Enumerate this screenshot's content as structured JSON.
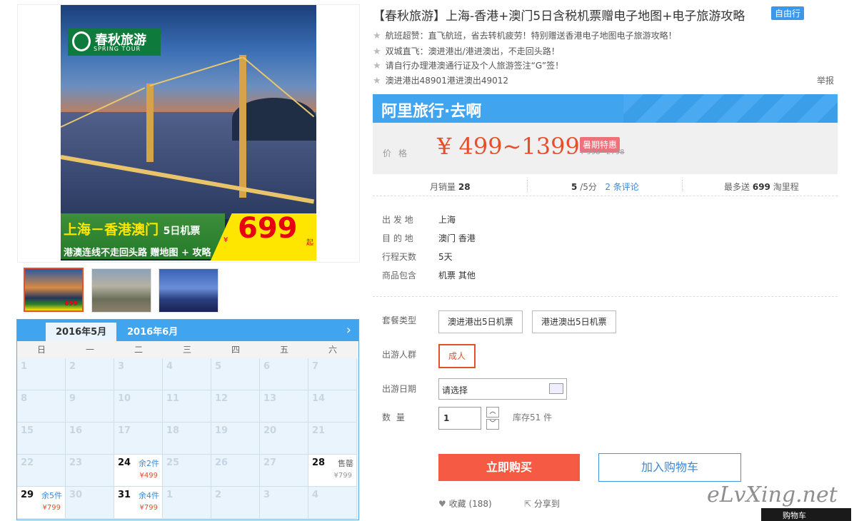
{
  "product": {
    "title": "【春秋旅游】上海-香港+澳门5日含税机票赠电子地图+电子旅游攻略",
    "tag": "自由行",
    "features": [
      "航班超赞：直飞航班，省去转机疲劳！特别赠送香港电子地图电子旅游攻略！",
      "双城直飞：澳进港出/港进澳出，不走回头路！",
      "请自行办理港澳通行证及个人旅游签注“G”签！",
      "澳进港出48901港进澳出49012"
    ],
    "report": "举报"
  },
  "image": {
    "logo_cn": "春秋旅游",
    "logo_en": "SPRING TOUR",
    "banner_title": "上海－香港澳门",
    "banner_title_small": "5日机票",
    "banner_sub": "港澳连线不走回头路 赠地图 + 攻略",
    "banner_yen": "¥",
    "banner_price": "699",
    "banner_qi": "起",
    "thumb_price": "699"
  },
  "brand_bar": {
    "text": "阿里旅行·去啊"
  },
  "price": {
    "label": "价格",
    "range": "¥ 499~1399",
    "promo": "暑期特惠",
    "original": "¥ 998~2798"
  },
  "stats": {
    "sales_label": "月销量",
    "sales": "28",
    "score": "5",
    "score_unit": "/5分",
    "reviews": "2 条评论",
    "points_pre": "最多送",
    "points": "699",
    "points_post": "淘里程"
  },
  "info": [
    {
      "label": "出 发 地",
      "value": "上海"
    },
    {
      "label": "目 的 地",
      "value": "澳门   香港"
    },
    {
      "label": "行程天数",
      "value": "5天"
    },
    {
      "label": "商品包含",
      "value": "机票   其他"
    }
  ],
  "options": {
    "package_label": "套餐类型",
    "packages": [
      "澳进港出5日机票",
      "港进澳出5日机票"
    ],
    "group_label": "出游人群",
    "group": "成人",
    "date_label": "出游日期",
    "date_placeholder": "请选择",
    "qty_label": "数    量",
    "qty": "1",
    "qty_up": "︿",
    "qty_down": "﹀",
    "stock": "库存51 件"
  },
  "actions": {
    "buy": "立即购买",
    "cart": "加入购物车",
    "fav": "收藏",
    "fav_count": "(188)",
    "share": "分享到"
  },
  "calendar": {
    "tabs": [
      "2016年5月",
      "2016年6月"
    ],
    "next": "›",
    "weekdays": [
      "日",
      "一",
      "二",
      "三",
      "四",
      "五",
      "六"
    ],
    "days": [
      {
        "d": "1"
      },
      {
        "d": "2"
      },
      {
        "d": "3"
      },
      {
        "d": "4"
      },
      {
        "d": "5"
      },
      {
        "d": "6"
      },
      {
        "d": "7"
      },
      {
        "d": "8"
      },
      {
        "d": "9"
      },
      {
        "d": "10"
      },
      {
        "d": "11"
      },
      {
        "d": "12"
      },
      {
        "d": "13"
      },
      {
        "d": "14"
      },
      {
        "d": "15"
      },
      {
        "d": "16"
      },
      {
        "d": "17"
      },
      {
        "d": "18"
      },
      {
        "d": "19"
      },
      {
        "d": "20"
      },
      {
        "d": "21"
      },
      {
        "d": "22"
      },
      {
        "d": "23"
      },
      {
        "d": "24",
        "on": true,
        "stock": "余2件",
        "price": "¥499"
      },
      {
        "d": "25"
      },
      {
        "d": "26"
      },
      {
        "d": "27"
      },
      {
        "d": "28",
        "on": true,
        "soldout": true,
        "stock": "售罄",
        "price": "¥799"
      },
      {
        "d": "29",
        "on": true,
        "stock": "余5件",
        "price": "¥799"
      },
      {
        "d": "30"
      },
      {
        "d": "31",
        "on": true,
        "stock": "余4件",
        "price": "¥799"
      },
      {
        "d": "1"
      },
      {
        "d": "2"
      },
      {
        "d": "3"
      },
      {
        "d": "4"
      }
    ]
  },
  "watermark": "eLvXing.net",
  "corner": "购物车"
}
